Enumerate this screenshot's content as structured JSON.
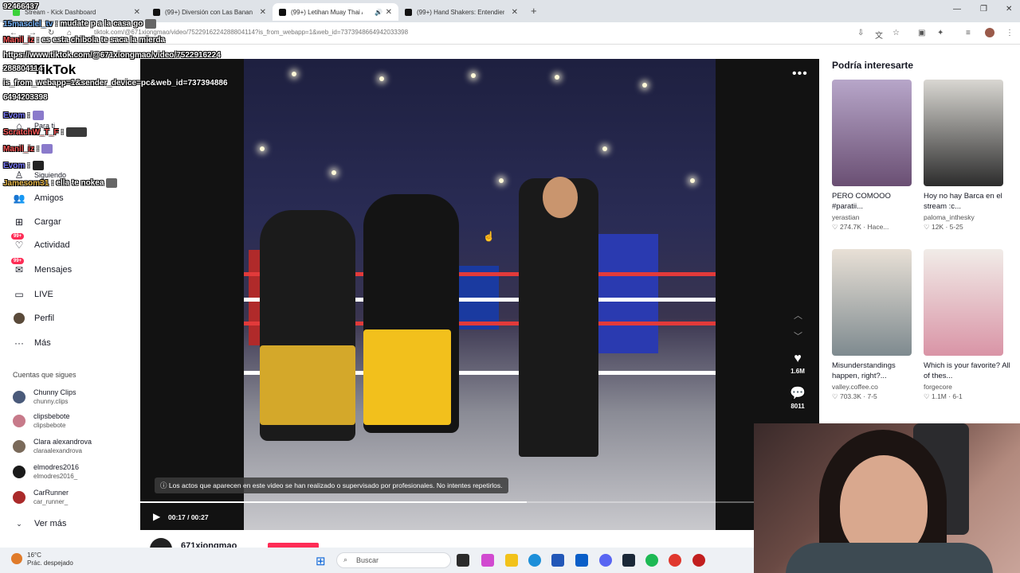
{
  "browser": {
    "tabs": [
      {
        "label": "Stream - Kick Dashboard",
        "active": false
      },
      {
        "label": "(99+) Diversión con Las Bananas",
        "active": false
      },
      {
        "label": "(99+) Letihan Muay Thai An",
        "active": true
      },
      {
        "label": "(99+) Hand Shakers: Entendien",
        "active": false
      }
    ],
    "url": "tiktok.com/@671xiongmao/video/7522916224288804114?is_from_webapp=1&web_id=7373948664942033398"
  },
  "sidebar": {
    "logo": "TikTok",
    "items": [
      {
        "label": "Para ti",
        "icon": "home-icon",
        "badge": ""
      },
      {
        "label": "Siguiendo",
        "icon": "following-icon",
        "badge": ""
      },
      {
        "label": "Amigos",
        "icon": "friends-icon",
        "badge": ""
      },
      {
        "label": "Cargar",
        "icon": "upload-icon",
        "badge": ""
      },
      {
        "label": "Actividad",
        "icon": "activity-icon",
        "badge": "99+"
      },
      {
        "label": "Mensajes",
        "icon": "messages-icon",
        "badge": "99+"
      },
      {
        "label": "LIVE",
        "icon": "live-icon",
        "badge": ""
      },
      {
        "label": "Perfil",
        "icon": "profile-icon",
        "badge": ""
      },
      {
        "label": "Más",
        "icon": "more-icon",
        "badge": ""
      }
    ],
    "following_title": "Cuentas que sigues",
    "accounts": [
      {
        "name": "Chunny Clips",
        "handle": "chunny.clips",
        "color": "#4a5a7a"
      },
      {
        "name": "clipsbebote",
        "handle": "clipsbebote",
        "color": "#c77a8a"
      },
      {
        "name": "Clara alexandrova",
        "handle": "claraalexandrova",
        "color": "#7a6a5a"
      },
      {
        "name": "elmodres2016",
        "handle": "elmodres2016_",
        "color": "#1a1a1a"
      },
      {
        "name": "CarRunner",
        "handle": "car_runner_",
        "color": "#aa2a2a"
      }
    ],
    "see_more": "Ver más"
  },
  "video": {
    "notice": "Los actos que aparecen en este video se han realizado o supervisado por profesionales. No intentes repetirlos.",
    "time": "00:17 / 00:27",
    "progress": 0.63,
    "likes": "1.6M",
    "comments": "8011",
    "author": "671xiongmao"
  },
  "recommendations": {
    "title": "Podría interesarte",
    "cards": [
      {
        "caption": "PERO COMOOO #paratii...",
        "author": "yerastian",
        "stats": "♡ 274.7K · Hace...",
        "colors": [
          "#b7a6c9",
          "#6a4f73"
        ]
      },
      {
        "caption": "Hoy no hay Barca en el stream :c...",
        "author": "paloma_inthesky",
        "stats": "♡ 12K · 5-25",
        "colors": [
          "#d9d7d2",
          "#2c2c2c"
        ]
      },
      {
        "caption": "Misunderstandings happen, right?...",
        "author": "valley.coffee.co",
        "stats": "♡ 703.3K · 7-5",
        "colors": [
          "#e8e0d6",
          "#7e8a8f"
        ]
      },
      {
        "caption": "Which is your favorite? All of thes...",
        "author": "forgecore",
        "stats": "♡ 1.1M · 6-1",
        "colors": [
          "#f1ece8",
          "#d994a6"
        ]
      }
    ]
  },
  "chat": [
    {
      "user": "92466437",
      "text": "",
      "ucolor": "#fff"
    },
    {
      "user": "15masclel_tv",
      "text": ": mudate p a la casa go",
      "ucolor": "#7ab8ff"
    },
    {
      "user": "Manil_iz",
      "text": ": es esta chibola te saca la mierda",
      "ucolor": "#ff5a5a"
    },
    {
      "user": "",
      "text": "https://www.tiktok.com/@671xiongmao/video/7522916224",
      "ucolor": "#fff"
    },
    {
      "user": "",
      "text": "288804114",
      "ucolor": "#fff"
    },
    {
      "user": "",
      "text": "is_from_webapp=1&sender_device=pc&web_id=737394886",
      "ucolor": "#fff"
    },
    {
      "user": "",
      "text": "6494203398",
      "ucolor": "#fff"
    },
    {
      "user": "Evom",
      "text": ":",
      "ucolor": "#7a7aff"
    },
    {
      "user": "ScratchW_T_F",
      "text": ":",
      "ucolor": "#ff5a5a"
    },
    {
      "user": "Manil_iz",
      "text": ":",
      "ucolor": "#ff5a5a"
    },
    {
      "user": "Evom",
      "text": ":",
      "ucolor": "#7a7aff"
    },
    {
      "user": "Jamesom31",
      "text": ": ella te nokea",
      "ucolor": "#e8b84a"
    }
  ],
  "taskbar": {
    "temperature": "16°C",
    "weather": "Prác. despejado",
    "search": "Buscar"
  }
}
